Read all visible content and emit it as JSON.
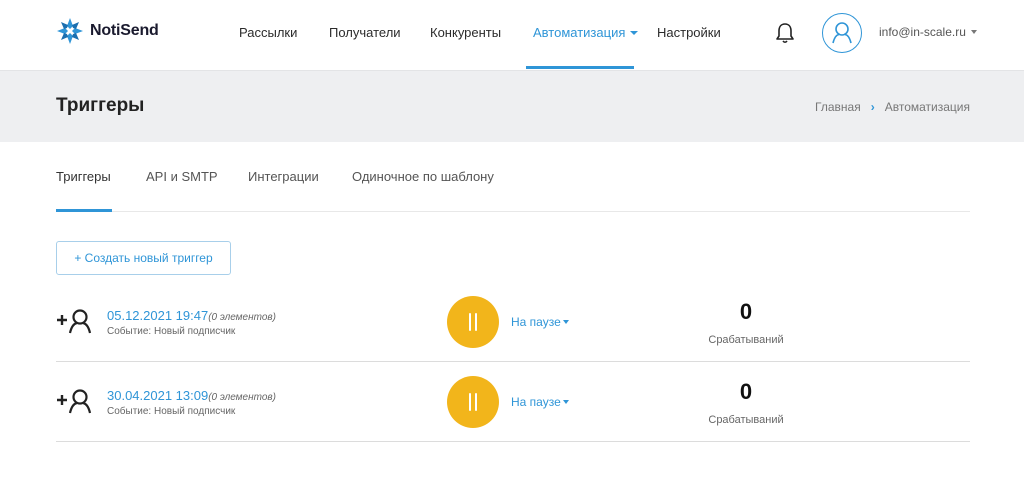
{
  "header": {
    "logo_text": "NotiSend",
    "nav": [
      {
        "label": "Рассылки"
      },
      {
        "label": "Получатели"
      },
      {
        "label": "Конкуренты"
      },
      {
        "label": "Автоматизация"
      },
      {
        "label": "Настройки"
      }
    ],
    "user_email": "info@in-scale.ru"
  },
  "page": {
    "title": "Триггеры",
    "breadcrumb": [
      "Главная",
      "Автоматизация"
    ]
  },
  "tabs": [
    {
      "label": "Триггеры"
    },
    {
      "label": "API и SMTP"
    },
    {
      "label": "Интеграции"
    },
    {
      "label": "Одиночное по шаблону"
    }
  ],
  "create_button_label": "+ Создать новый триггер",
  "triggers": [
    {
      "date": "05.12.2021 19:47",
      "count": "(0 элементов)",
      "event": "Событие: Новый подписчик",
      "status": "На паузе",
      "fire_count": "0",
      "fire_label": "Срабатываний"
    },
    {
      "date": "30.04.2021 13:09",
      "count": "(0 элементов)",
      "event": "Событие: Новый подписчик",
      "status": "На паузе",
      "fire_count": "0",
      "fire_label": "Срабатываний"
    }
  ],
  "colors": {
    "accent": "#2f95d7",
    "pause": "#f2b51b",
    "band": "#eeeff1"
  },
  "icons": [
    "notisend-logo-icon",
    "bell-icon",
    "user-avatar-icon",
    "add-user-icon",
    "pause-icon"
  ]
}
